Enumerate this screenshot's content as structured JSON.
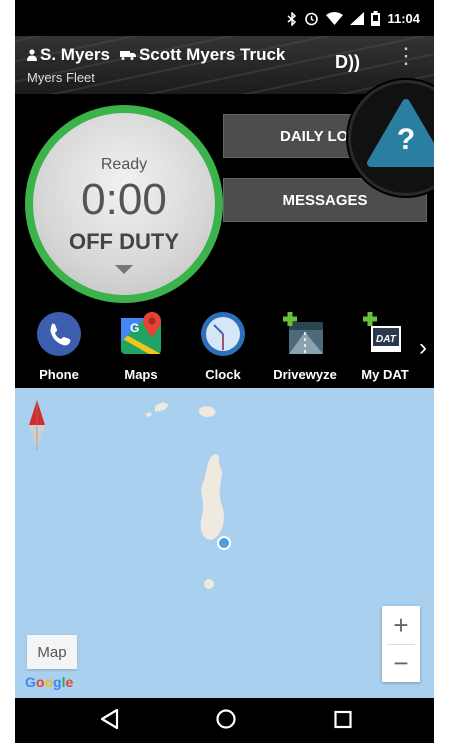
{
  "statusbar": {
    "time": "11:04",
    "icons": [
      "bluetooth-icon",
      "alarm-icon",
      "wifi-icon",
      "signal-icon",
      "battery-icon"
    ]
  },
  "header": {
    "driver": "S. Myers",
    "truck": "Scott Myers Truck",
    "fleet": "Myers Fleet",
    "dbutton": "D))",
    "menu": "⋮"
  },
  "duty": {
    "status_label": "Ready",
    "time": "0:00",
    "status": "OFF DUTY",
    "ring_color": "#3bb34a"
  },
  "buttons": {
    "daily_logs": "DAILY LOGS",
    "messages": "MESSAGES",
    "help": "?"
  },
  "apps": [
    {
      "label": "Phone",
      "icon": "phone-icon"
    },
    {
      "label": "Maps",
      "icon": "maps-icon"
    },
    {
      "label": "Clock",
      "icon": "clock-icon"
    },
    {
      "label": "Drivewyze",
      "icon": "drivewyze-icon"
    },
    {
      "label": "My DAT",
      "icon": "my-dat-icon"
    }
  ],
  "map": {
    "type_button": "Map",
    "attribution": "Google",
    "zoom_in": "+",
    "zoom_out": "−",
    "water_color": "#a9d0ef",
    "land_color": "#efe9df"
  },
  "navbar": {
    "icons": [
      "back-icon",
      "home-icon",
      "recents-icon"
    ]
  }
}
